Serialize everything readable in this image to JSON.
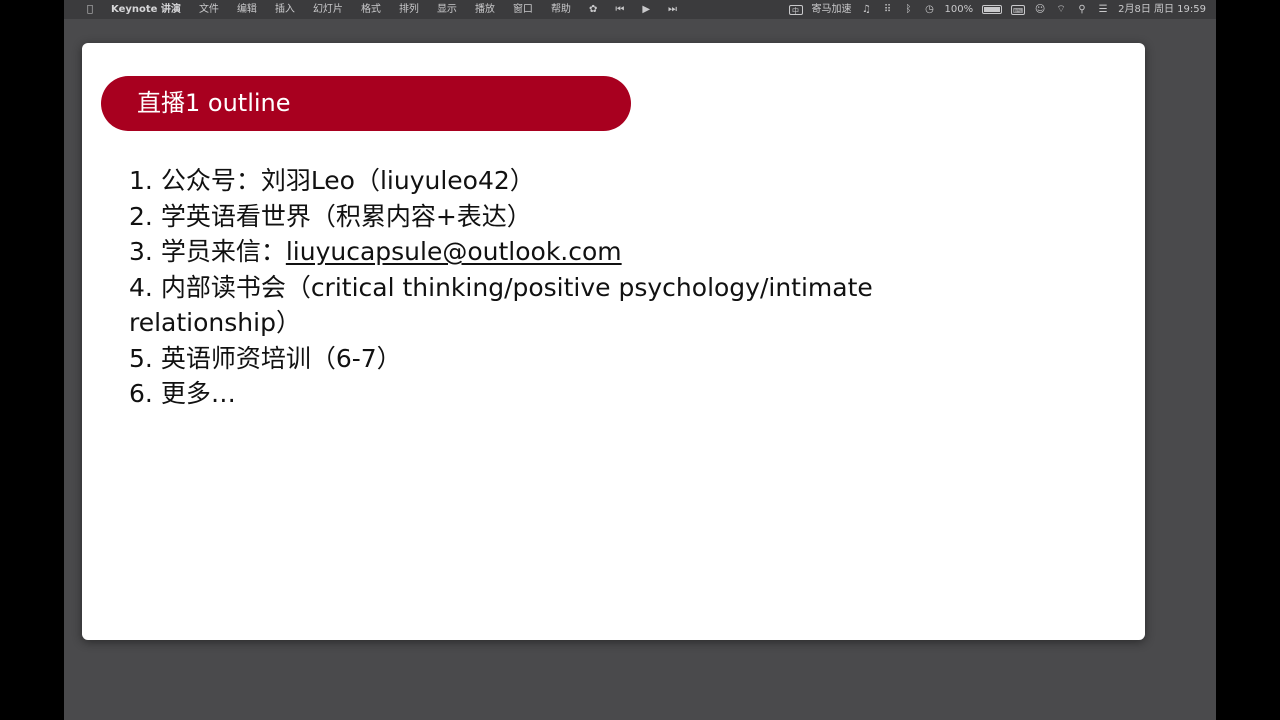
{
  "menubar": {
    "apple_icon": "apple-icon",
    "items": [
      "Keynote 讲演",
      "文件",
      "编辑",
      "插入",
      "幻灯片",
      "格式",
      "排列",
      "显示",
      "播放",
      "窗口",
      "帮助"
    ],
    "status": {
      "rewind_label": "⏮",
      "play_label": "▶",
      "forward_label": "⏭",
      "app_label": "寄马加速",
      "zoom": "100%",
      "datetime": "2月8日 周日 19:59"
    }
  },
  "slide": {
    "title": "直播1 outline",
    "title_color": "#a8001f",
    "items": [
      {
        "num": "1.",
        "text": "公众号：刘羽Leo（liuyuleo42）"
      },
      {
        "num": "2.",
        "text": "学英语看世界（积累内容+表达）"
      },
      {
        "num": "3.",
        "text_prefix": "学员来信：",
        "email": "liuyucapsule@outlook.com"
      },
      {
        "num": "4.",
        "text": "内部读书会（critical thinking/positive psychology/intimate relationship）"
      },
      {
        "num": "5.",
        "text": "英语师资培训（6-7）"
      },
      {
        "num": "6.",
        "text": "更多…"
      }
    ]
  }
}
